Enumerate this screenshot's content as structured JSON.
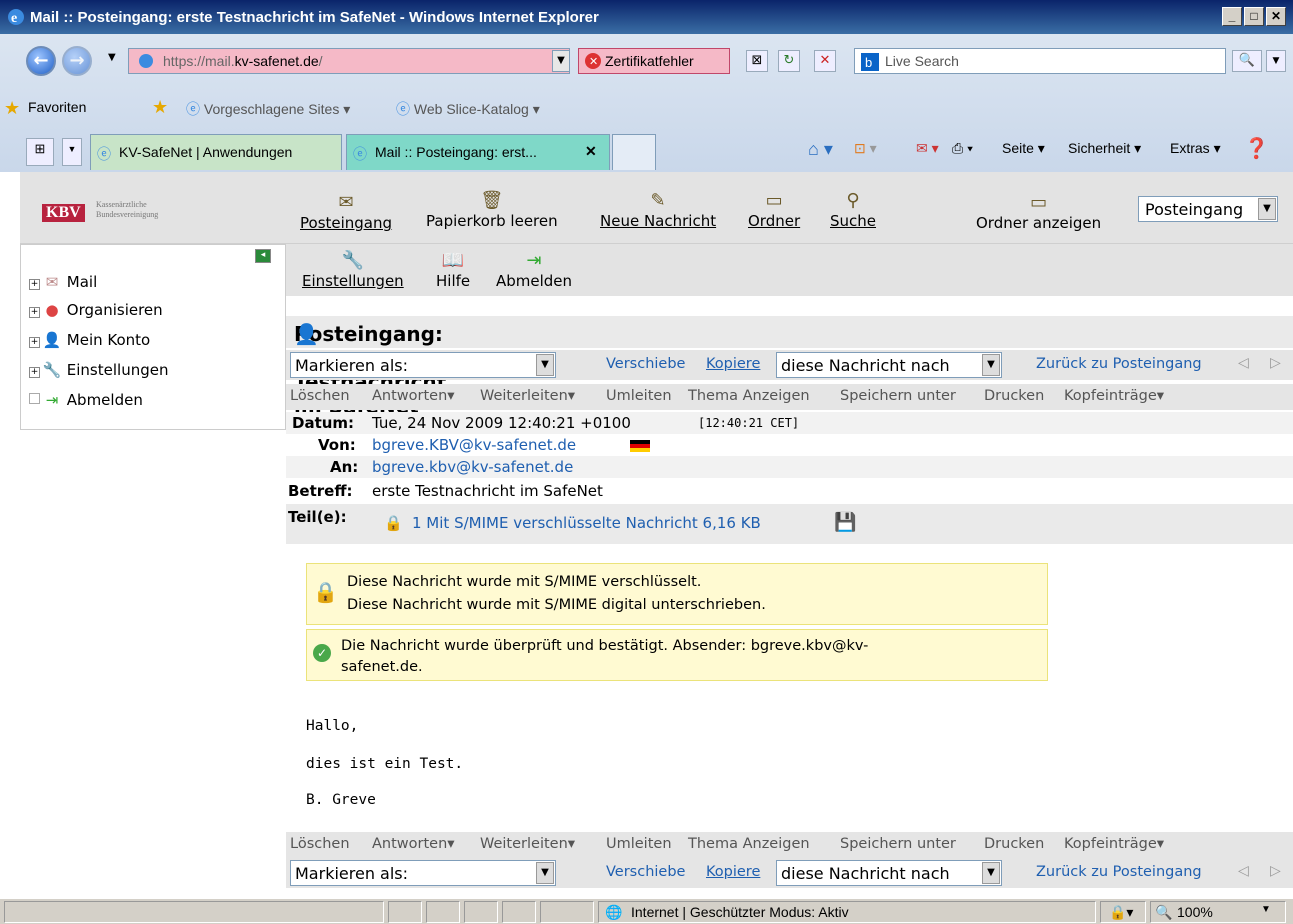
{
  "window": {
    "title": "Mail :: Posteingang: erste Testnachricht im SafeNet - Windows Internet Explorer"
  },
  "browser": {
    "url_prefix": "https://mail.",
    "url_domain": "kv-safenet.de",
    "url_suffix": "/",
    "cert_error": "Zertifikatfehler",
    "search_placeholder": "Live Search",
    "favorites": "Favoriten",
    "suggested_sites": "Vorgeschlagene Sites",
    "web_slice": "Web Slice-Katalog",
    "tabs": [
      {
        "label": "KV-SafeNet | Anwendungen"
      },
      {
        "label": "Mail :: Posteingang: erst..."
      }
    ],
    "cmd": {
      "page": "Seite",
      "security": "Sicherheit",
      "extras": "Extras"
    }
  },
  "app": {
    "logo_text": "KBV",
    "logo_sub1": "Kassenärztliche",
    "logo_sub2": "Bundesvereinigung",
    "toolbar": {
      "inbox": "Posteingang",
      "empty_trash": "Papierkorb leeren",
      "new_message": "Neue Nachricht",
      "folders": "Ordner",
      "search": "Suche",
      "show_folders": "Ordner anzeigen",
      "folder_select": "Posteingang"
    },
    "toolbar2": {
      "settings": "Einstellungen",
      "help": "Hilfe",
      "logout": "Abmelden"
    },
    "sidebar": [
      {
        "label": "Mail"
      },
      {
        "label": "Organisieren"
      },
      {
        "label": "Mein Konto"
      },
      {
        "label": "Einstellungen"
      },
      {
        "label": "Abmelden"
      }
    ]
  },
  "message": {
    "title": "Posteingang: erste Testnachricht im SafeNet (1 von 1)",
    "mark_as": "Markieren als:",
    "move": "Verschiebe",
    "copy": "Kopiere",
    "target": "diese Nachricht nach",
    "back": "Zurück zu Posteingang",
    "actions": [
      "Löschen",
      "Antworten",
      "Weiterleiten",
      "Umleiten",
      "Thema Anzeigen",
      "Speichern unter",
      "Drucken",
      "Kopfeinträge"
    ],
    "date_label": "Datum:",
    "date_value": "Tue, 24 Nov 2009 12:40:21 +0100",
    "date_local": "[12:40:21 CET]",
    "from_label": "Von:",
    "from_value": "bgreve.KBV@kv-safenet.de",
    "to_label": "An:",
    "to_value": "bgreve.kbv@kv-safenet.de",
    "subject_label": "Betreff:",
    "subject_value": "erste Testnachricht im SafeNet",
    "parts_label": "Teil(e):",
    "parts_value": "1 Mit S/MIME verschlüsselte Nachricht 6,16 KB",
    "notice_encrypted_1": "Diese Nachricht wurde mit S/MIME verschlüsselt.",
    "notice_encrypted_2": "Diese Nachricht wurde mit S/MIME digital unterschrieben.",
    "notice_verified_1": "Die Nachricht wurde überprüft und bestätigt. Absender: bgreve.kbv@kv-",
    "notice_verified_2": "safenet.de.",
    "body": [
      "Hallo,",
      "dies ist ein Test.",
      "B. Greve"
    ]
  },
  "status": {
    "zone": "Internet | Geschützter Modus: Aktiv",
    "zoom": "100%"
  }
}
